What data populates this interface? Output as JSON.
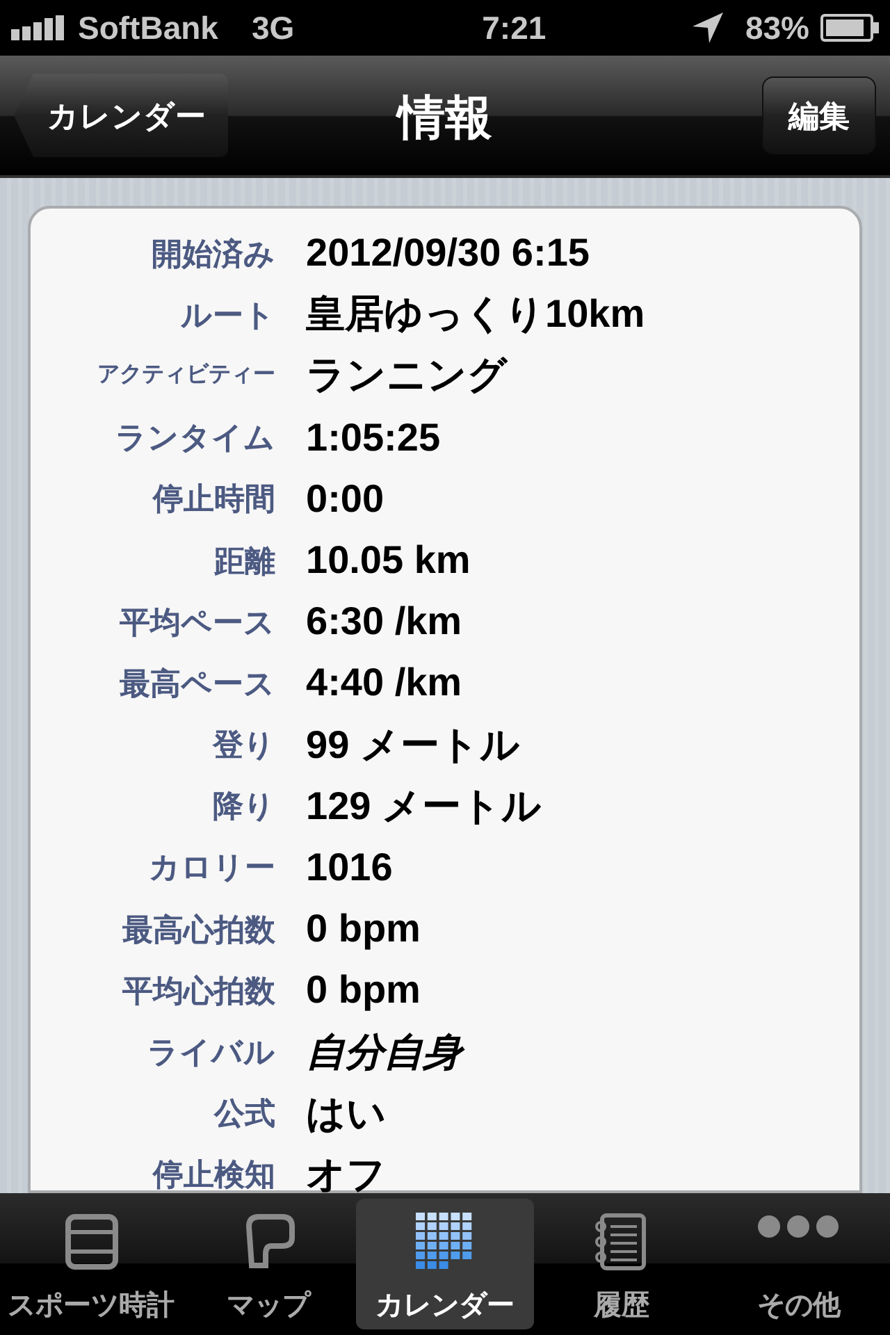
{
  "status_bar": {
    "carrier": "SoftBank",
    "network": "3G",
    "time": "7:21",
    "battery": "83%"
  },
  "nav_bar": {
    "back": "カレンダー",
    "title": "情報",
    "action": "編集"
  },
  "fields": [
    {
      "label": "開始済み",
      "value": "2012/09/30 6:15",
      "italic": false
    },
    {
      "label": "ルート",
      "value": "皇居ゆっくり10km",
      "italic": false
    },
    {
      "label": "アクティビティー",
      "value": "ランニング",
      "italic": false
    },
    {
      "label": "ランタイム",
      "value": "1:05:25",
      "italic": false
    },
    {
      "label": "停止時間",
      "value": "0:00",
      "italic": false
    },
    {
      "label": "距離",
      "value": "10.05 km",
      "italic": false
    },
    {
      "label": "平均ペース",
      "value": "6:30 /km",
      "italic": false
    },
    {
      "label": "最高ペース",
      "value": "4:40 /km",
      "italic": false
    },
    {
      "label": "登り",
      "value": "99 メートル",
      "italic": false
    },
    {
      "label": "降り",
      "value": "129 メートル",
      "italic": false
    },
    {
      "label": "カロリー",
      "value": "1016",
      "italic": false
    },
    {
      "label": "最高心拍数",
      "value": "0 bpm",
      "italic": false
    },
    {
      "label": "平均心拍数",
      "value": "0 bpm",
      "italic": false
    },
    {
      "label": "ライバル",
      "value": "自分自身",
      "italic": true
    },
    {
      "label": "公式",
      "value": "はい",
      "italic": false
    },
    {
      "label": "停止検知",
      "value": "オフ",
      "italic": false
    }
  ],
  "tab_bar": [
    {
      "kind": "stopwatch",
      "label": "スポーツ時計",
      "selected": false
    },
    {
      "kind": "map",
      "label": "マップ",
      "selected": false
    },
    {
      "kind": "calendar",
      "label": "カレンダー",
      "selected": true
    },
    {
      "kind": "history",
      "label": "履歴",
      "selected": false
    },
    {
      "kind": "more",
      "label": "その他",
      "selected": false
    }
  ]
}
